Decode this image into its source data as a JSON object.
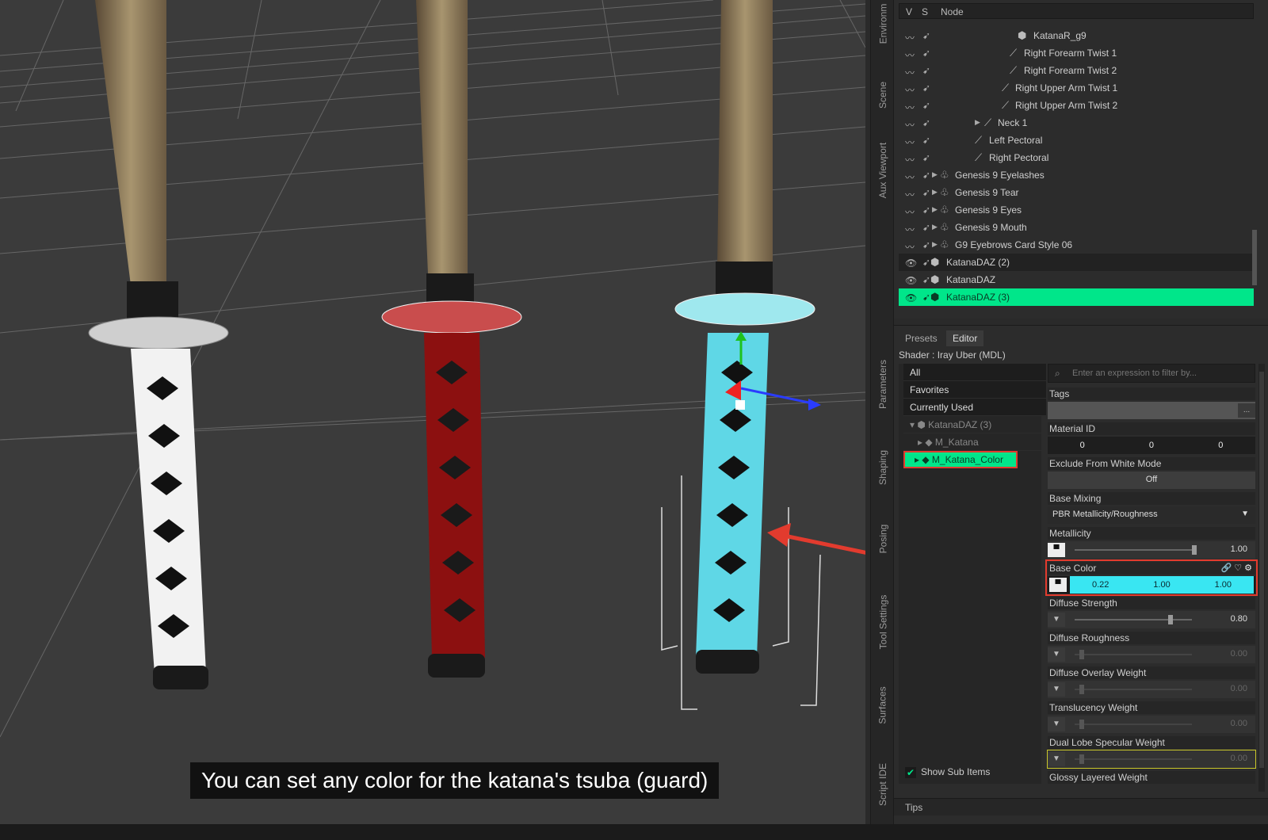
{
  "caption": "You can set any color for the katana's tsuba (guard)",
  "vertical_tabs": [
    "Environm",
    "Scene",
    "Aux Viewport",
    "Parameters",
    "Shaping",
    "Posing",
    "Tool Settings",
    "Surfaces",
    "Script IDE"
  ],
  "scene": {
    "col_v": "V",
    "col_s": "S",
    "col_node": "Node",
    "rows": [
      {
        "label": "KatanaR_g9"
      },
      {
        "label": "Right Forearm Twist 1"
      },
      {
        "label": "Right Forearm Twist 2"
      },
      {
        "label": "Right Upper Arm Twist 1"
      },
      {
        "label": "Right Upper Arm Twist 2"
      },
      {
        "label": "Neck 1"
      },
      {
        "label": "Left Pectoral"
      },
      {
        "label": "Right Pectoral"
      },
      {
        "label": "Genesis 9 Eyelashes"
      },
      {
        "label": "Genesis 9 Tear"
      },
      {
        "label": "Genesis 9 Eyes"
      },
      {
        "label": "Genesis 9 Mouth"
      },
      {
        "label": "G9 Eyebrows Card Style 06"
      },
      {
        "label": "KatanaDAZ (2)"
      },
      {
        "label": "KatanaDAZ"
      },
      {
        "label": "KatanaDAZ (3)"
      }
    ]
  },
  "surfaces": {
    "tabs": [
      "Presets",
      "Editor"
    ],
    "shader": "Shader :  Iray Uber (MDL)",
    "filters": [
      "All",
      "Favorites",
      "Currently Used"
    ],
    "tree": [
      "KatanaDAZ (3)",
      "M_Katana",
      "M_Katana_Color"
    ],
    "show_sub_items": "Show Sub Items",
    "tips": "Tips",
    "filter_placeholder": "Enter an expression to filter by...",
    "props": {
      "tags": "Tags",
      "material_id": {
        "label": "Material ID",
        "values": [
          "0",
          "0",
          "0"
        ]
      },
      "exclude": {
        "label": "Exclude From White Mode",
        "value": "Off"
      },
      "base_mixing": {
        "label": "Base Mixing",
        "value": "PBR Metallicity/Roughness"
      },
      "metallicity": {
        "label": "Metallicity",
        "value": "1.00",
        "level": 1.0
      },
      "base_color": {
        "label": "Base Color",
        "values": [
          "0.22",
          "1.00",
          "1.00"
        ],
        "color": "#39e6f2"
      },
      "diffuse_strength": {
        "label": "Diffuse Strength",
        "value": "0.80",
        "level": 0.8
      },
      "diffuse_roughness": {
        "label": "Diffuse Roughness",
        "value": "0.00"
      },
      "diffuse_overlay": {
        "label": "Diffuse Overlay Weight",
        "value": "0.00"
      },
      "translucency": {
        "label": "Translucency Weight",
        "value": "0.00"
      },
      "dual_lobe": {
        "label": "Dual Lobe Specular Weight",
        "value": "0.00"
      },
      "glossy": {
        "label": "Glossy Layered Weight"
      }
    }
  },
  "colors": {
    "accent": "#00e68a",
    "highlight_red": "#e23b2e",
    "base_color_swatch": "#39e6f2"
  }
}
